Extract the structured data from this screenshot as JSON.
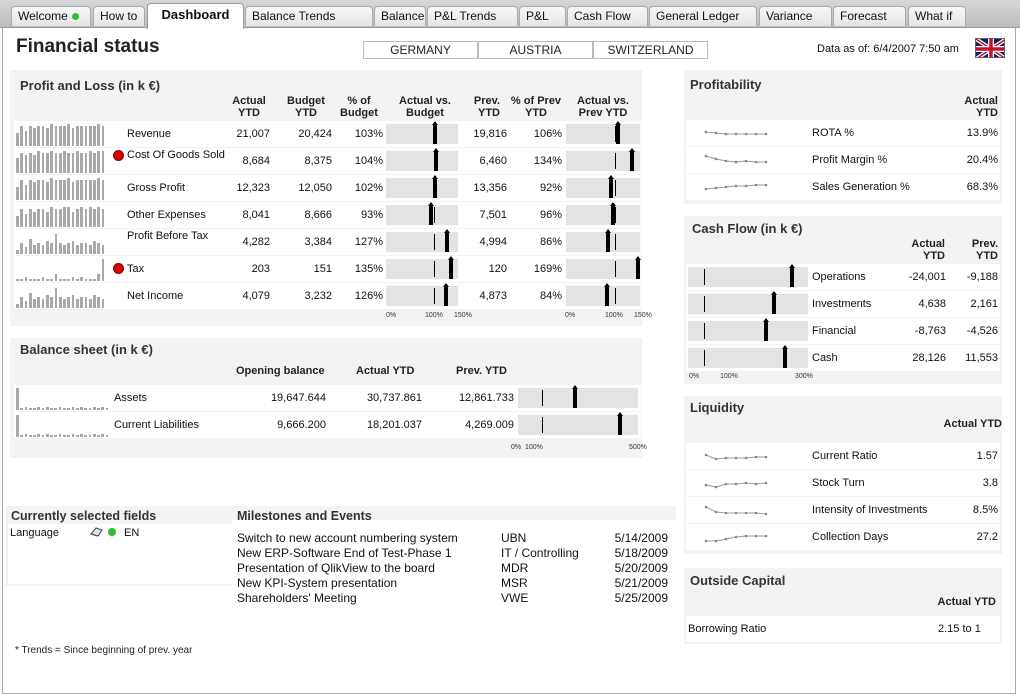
{
  "tabs": [
    {
      "label": "Welcome",
      "active": false,
      "status": true
    },
    {
      "label": "How to",
      "active": false
    },
    {
      "label": "Dashboard",
      "active": true
    },
    {
      "label": "Balance Trends",
      "active": false
    },
    {
      "label": "Balance",
      "active": false
    },
    {
      "label": "P&L Trends",
      "active": false
    },
    {
      "label": "P&L",
      "active": false
    },
    {
      "label": "Cash Flow",
      "active": false
    },
    {
      "label": "General Ledger",
      "active": false
    },
    {
      "label": "Variance",
      "active": false
    },
    {
      "label": "Forecast",
      "active": false
    },
    {
      "label": "What if",
      "active": false
    }
  ],
  "page_title": "Financial status",
  "countries": [
    "GERMANY",
    "AUSTRIA",
    "SWITZERLAND"
  ],
  "data_as_of": "Data as of: 6/4/2007 7:50 am",
  "flag_icon": "uk-flag-icon",
  "pl": {
    "title": "Profit and Loss (in k €)",
    "headers": {
      "actual": "Actual YTD",
      "budget": "Budget YTD",
      "pct_budget": "% of Budget",
      "act_vs_budget": "Actual vs. Budget",
      "prev": "Prev. YTD",
      "pct_prev": "% of Prev YTD",
      "act_vs_prev": "Actual vs. Prev YTD"
    },
    "rows": [
      {
        "label": "Revenue",
        "actual": "21,007",
        "budget": "20,424",
        "pct_budget": "103%",
        "prev": "19,816",
        "pct_prev": "106%",
        "alert": false,
        "gauge_budget": 1.03,
        "gauge_prev": 1.06,
        "trend": [
          0.6,
          0.9,
          0.7,
          0.9,
          0.8,
          0.9,
          0.9,
          0.8,
          1,
          0.9,
          0.9,
          0.9,
          1,
          0.8,
          0.9,
          0.9,
          0.9,
          0.9,
          0.9,
          1,
          0.9
        ]
      },
      {
        "label": "Cost Of Goods Sold",
        "actual": "8,684",
        "budget": "8,375",
        "pct_budget": "104%",
        "prev": "6,460",
        "pct_prev": "134%",
        "alert": true,
        "gauge_budget": 1.04,
        "gauge_prev": 1.34,
        "trend": [
          0.7,
          0.9,
          0.8,
          0.9,
          0.8,
          1,
          0.9,
          0.9,
          1,
          0.9,
          0.9,
          1,
          0.9,
          0.9,
          1,
          0.9,
          0.9,
          1,
          0.9,
          1,
          1
        ]
      },
      {
        "label": "Gross Profit",
        "actual": "12,323",
        "budget": "12,050",
        "pct_budget": "102%",
        "prev": "13,356",
        "pct_prev": "92%",
        "alert": false,
        "gauge_budget": 1.02,
        "gauge_prev": 0.92,
        "trend": [
          0.6,
          0.9,
          0.7,
          0.9,
          0.8,
          0.9,
          0.9,
          0.8,
          1,
          0.9,
          0.9,
          0.9,
          1,
          0.8,
          0.9,
          0.9,
          0.9,
          0.9,
          0.9,
          1,
          0.9
        ]
      },
      {
        "label": "Other Expenses",
        "actual": "8,041",
        "budget": "8,666",
        "pct_budget": "93%",
        "prev": "7,501",
        "pct_prev": "96%",
        "alert": false,
        "gauge_budget": 0.93,
        "gauge_prev": 0.96,
        "trend": [
          0.5,
          0.8,
          0.6,
          0.8,
          0.7,
          0.8,
          0.8,
          0.7,
          0.9,
          0.8,
          0.8,
          0.9,
          0.9,
          0.7,
          0.8,
          0.9,
          0.8,
          0.9,
          0.8,
          0.9,
          0.8
        ]
      },
      {
        "label": "Profit Before Tax",
        "actual": "4,282",
        "budget": "3,384",
        "pct_budget": "127%",
        "prev": "4,994",
        "pct_prev": "86%",
        "alert": false,
        "gauge_budget": 1.27,
        "gauge_prev": 0.86,
        "trend": [
          0.2,
          0.5,
          0.3,
          0.7,
          0.4,
          0.5,
          0.4,
          0.6,
          0.5,
          0.9,
          0.5,
          0.4,
          0.5,
          0.6,
          0.4,
          0.5,
          0.5,
          0.4,
          0.6,
          0.5,
          0.4
        ]
      },
      {
        "label": "Tax",
        "actual": "203",
        "budget": "151",
        "pct_budget": "135%",
        "prev": "120",
        "pct_prev": "169%",
        "alert": true,
        "gauge_budget": 1.35,
        "gauge_prev": 1.69,
        "trend": [
          0.1,
          0.1,
          0.2,
          0.1,
          0.1,
          0.1,
          0.2,
          0.1,
          0.1,
          0.3,
          0.1,
          0.1,
          0.1,
          0.2,
          0.1,
          0.2,
          0.1,
          0.1,
          0.1,
          0.3,
          1
        ]
      },
      {
        "label": "Net Income",
        "actual": "4,079",
        "budget": "3,232",
        "pct_budget": "126%",
        "prev": "4,873",
        "pct_prev": "84%",
        "alert": false,
        "gauge_budget": 1.26,
        "gauge_prev": 0.84,
        "trend": [
          0.2,
          0.5,
          0.3,
          0.7,
          0.4,
          0.5,
          0.4,
          0.6,
          0.5,
          0.9,
          0.5,
          0.4,
          0.5,
          0.6,
          0.4,
          0.5,
          0.5,
          0.4,
          0.6,
          0.5,
          0.4
        ]
      }
    ],
    "axis": [
      "0%",
      "100%",
      "150%"
    ]
  },
  "balance": {
    "title": "Balance sheet (in k €)",
    "headers": {
      "opening": "Opening balance",
      "actual": "Actual YTD",
      "prev": "Prev. YTD"
    },
    "rows": [
      {
        "label": "Assets",
        "opening": "19,647.644",
        "actual": "30,737.861",
        "prev": "12,861.733",
        "gauge": 2.39
      },
      {
        "label": "Current Liabilities",
        "opening": "9,666.200",
        "actual": "18,201.037",
        "prev": "4,269.009",
        "gauge": 4.26
      }
    ],
    "axis": [
      "0%",
      "100%",
      "500%"
    ]
  },
  "profitability": {
    "title": "Profitability",
    "header": "Actual YTD",
    "rows": [
      {
        "label": "ROTA %",
        "value": "13.9%"
      },
      {
        "label": "Profit Margin %",
        "value": "20.4%"
      },
      {
        "label": "Sales Generation %",
        "value": "68.3%"
      }
    ]
  },
  "cashflow": {
    "title": "Cash Flow (in k €)",
    "headers": {
      "actual": "Actual YTD",
      "prev": "Prev. YTD"
    },
    "rows": [
      {
        "label": "Operations",
        "actual": "-24,001",
        "prev": "-9,188",
        "gauge": 2.61
      },
      {
        "label": "Investments",
        "actual": "4,638",
        "prev": "2,161",
        "gauge": 2.15
      },
      {
        "label": "Financial",
        "actual": "-8,763",
        "prev": "-4,526",
        "gauge": 1.94
      },
      {
        "label": "Cash",
        "actual": "28,126",
        "prev": "11,553",
        "gauge": 2.43
      }
    ],
    "axis": [
      "0%",
      "100%",
      "300%"
    ]
  },
  "liquidity": {
    "title": "Liquidity",
    "header": "Actual YTD",
    "rows": [
      {
        "label": "Current Ratio",
        "value": "1.57"
      },
      {
        "label": "Stock Turn",
        "value": "3.8"
      },
      {
        "label": "Intensity of Investments",
        "value": "8.5%"
      },
      {
        "label": "Collection Days",
        "value": "27.2"
      }
    ]
  },
  "outside_capital": {
    "title": "Outside Capital",
    "header": "Actual YTD",
    "rows": [
      {
        "label": "Borrowing Ratio",
        "value": "2.15 to 1"
      }
    ]
  },
  "selected": {
    "title": "Currently selected fields",
    "field": "Language",
    "value": "EN"
  },
  "milestones": {
    "title": "Milestones and Events",
    "rows": [
      {
        "event": "Switch to new account numbering system",
        "owner": "UBN",
        "date": "5/14/2009"
      },
      {
        "event": "New ERP-Software End of Test-Phase 1",
        "owner": "IT / Controlling",
        "date": "5/18/2009"
      },
      {
        "event": "Presentation of QlikView to the board",
        "owner": "MDR",
        "date": "5/20/2009"
      },
      {
        "event": "New KPI-System presentation",
        "owner": "MSR",
        "date": "5/21/2009"
      },
      {
        "event": "Shareholders' Meeting",
        "owner": "VWE",
        "date": "5/25/2009"
      }
    ]
  },
  "footnote": "* Trends = Since beginning of prev. year"
}
